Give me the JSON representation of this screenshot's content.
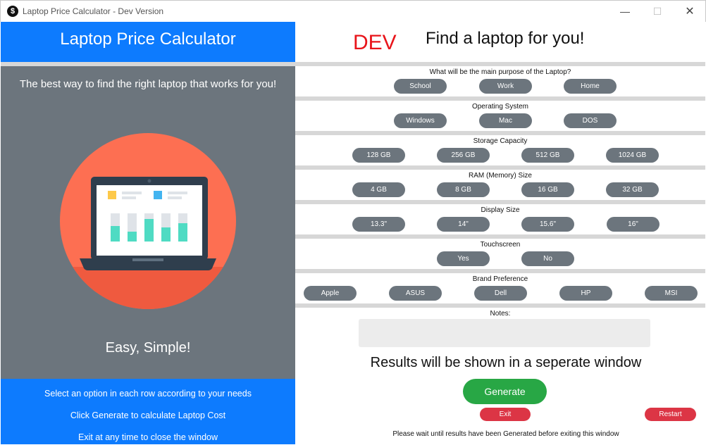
{
  "window": {
    "title": "Laptop Price Calculator - Dev Version",
    "app_icon_glyph": "$",
    "minimize_glyph": "—",
    "maximize_glyph": "☐",
    "close_glyph": "✕"
  },
  "left": {
    "header": "Laptop Price Calculator",
    "tagline": "The best way to find the right laptop that works for you!",
    "illustration_icon": "laptop-with-chart-icon",
    "slogan": "Easy, Simple!",
    "instructions": [
      "Select an option in each row according to your needs",
      "Click Generate to calculate Laptop Cost",
      "Exit at any time to close the window"
    ]
  },
  "right": {
    "dev_label": "DEV",
    "title": "Find a laptop for you!",
    "sections": {
      "purpose": {
        "label": "What will be the main purpose of the Laptop?",
        "options": [
          "School",
          "Work",
          "Home"
        ]
      },
      "os": {
        "label": "Operating System",
        "options": [
          "Windows",
          "Mac",
          "DOS"
        ]
      },
      "storage": {
        "label": "Storage Capacity",
        "options": [
          "128 GB",
          "256 GB",
          "512 GB",
          "1024 GB"
        ]
      },
      "ram": {
        "label": "RAM (Memory) Size",
        "options": [
          "4 GB",
          "8 GB",
          "16 GB",
          "32 GB"
        ]
      },
      "display": {
        "label": "Display Size",
        "options": [
          "13.3\"",
          "14\"",
          "15.6\"",
          "16\""
        ]
      },
      "touchscreen": {
        "label": "Touchscreen",
        "options": [
          "Yes",
          "No"
        ]
      },
      "brand": {
        "label": "Brand Preference",
        "options": [
          "Apple",
          "ASUS",
          "Dell",
          "HP",
          "MSI"
        ]
      }
    },
    "notes_label": "Notes:",
    "notes_value": "",
    "results_text": "Results will be shown in a seperate window",
    "generate_label": "Generate",
    "exit_label": "Exit",
    "restart_label": "Restart",
    "wait_text": "Please wait until results have been Generated before exiting this window"
  },
  "colors": {
    "primary_blue": "#0d7bfe",
    "panel_gray": "#6c757d",
    "dev_red": "#e8141a",
    "generate_green": "#28a745",
    "danger_red": "#dc3545"
  }
}
